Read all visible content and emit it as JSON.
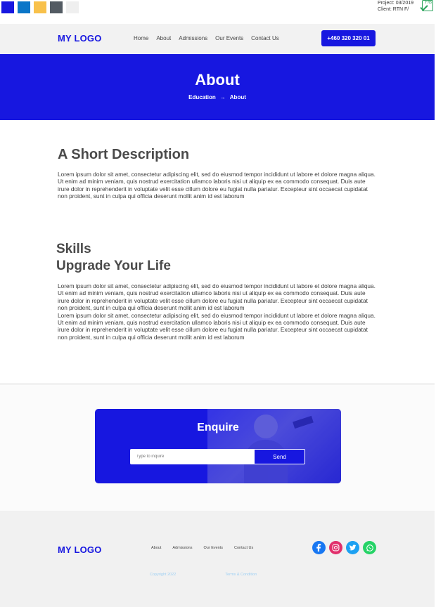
{
  "palette": {
    "colors": [
      "#1717e0",
      "#0a76c8",
      "#f8c14b",
      "#535b63",
      "#efefef"
    ]
  },
  "project_info": {
    "project": "Project: 03/2019",
    "client": "Client: RTN F/",
    "badge": "F/B"
  },
  "navbar": {
    "logo": "MY LOGO",
    "links": [
      "Home",
      "About",
      "Admissions",
      "Our Events",
      "Contact Us"
    ],
    "phone": "+460 320 320 01"
  },
  "hero": {
    "title": "About",
    "breadcrumb_from": "Education",
    "breadcrumb_arrow": "→",
    "breadcrumb_to": "About"
  },
  "description": {
    "heading": "A Short Description",
    "lines": [
      "Lorem ipsum dolor sit amet, consectetur adipiscing elit, sed do eiusmod tempor incididunt ut labore et dolore magna aliqua.",
      "Ut enim ad minim veniam, quis nostrud exercitation ullamco laboris nisi ut aliquip ex ea commodo consequat. Duis aute irure dolor in reprehenderit in voluptate velit esse cillum dolore eu fugiat nulla pariatur. Excepteur sint occaecat cupidatat non proident, sunt in culpa qui officia deserunt mollit anim id est laborum"
    ]
  },
  "skills": {
    "heading1": "Skills",
    "heading2": "Upgrade Your Life",
    "lines": [
      "Lorem ipsum dolor sit amet, consectetur adipiscing elit, sed do eiusmod tempor incididunt ut labore et dolore magna aliqua.",
      "Ut enim ad minim veniam, quis nostrud exercitation ullamco laboris nisi ut aliquip ex ea commodo consequat. Duis aute irure dolor in reprehenderit in voluptate velit esse cillum dolore eu fugiat nulla pariatur. Excepteur sint occaecat cupidatat non proident, sunt in culpa qui officia deserunt mollit anim id est laborum",
      "Lorem ipsum dolor sit amet, consectetur adipiscing elit, sed do eiusmod tempor incididunt ut labore et dolore magna aliqua.",
      "Ut enim ad minim veniam, quis nostrud exercitation ullamco laboris nisi ut aliquip ex ea commodo consequat. Duis aute irure dolor in reprehenderit in voluptate velit esse cillum dolore eu fugiat nulla pariatur. Excepteur sint occaecat cupidatat non proident, sunt in culpa qui officia deserunt mollit anim id est laborum"
    ]
  },
  "enquire": {
    "title": "Enquire",
    "placeholder": "Type to inquire",
    "send_label": "Send"
  },
  "footer": {
    "logo": "MY LOGO",
    "links": [
      "About",
      "Admissions",
      "Our Events",
      "Contact Us"
    ],
    "copyright": "Copyright 2022",
    "terms": "Terms & Condition",
    "socials": [
      {
        "icon": "facebook-icon",
        "color": "#1877f2"
      },
      {
        "icon": "instagram-icon",
        "color": "#e1306c"
      },
      {
        "icon": "twitter-icon",
        "color": "#1da1f2"
      },
      {
        "icon": "whatsapp-icon",
        "color": "#25d366"
      }
    ]
  }
}
